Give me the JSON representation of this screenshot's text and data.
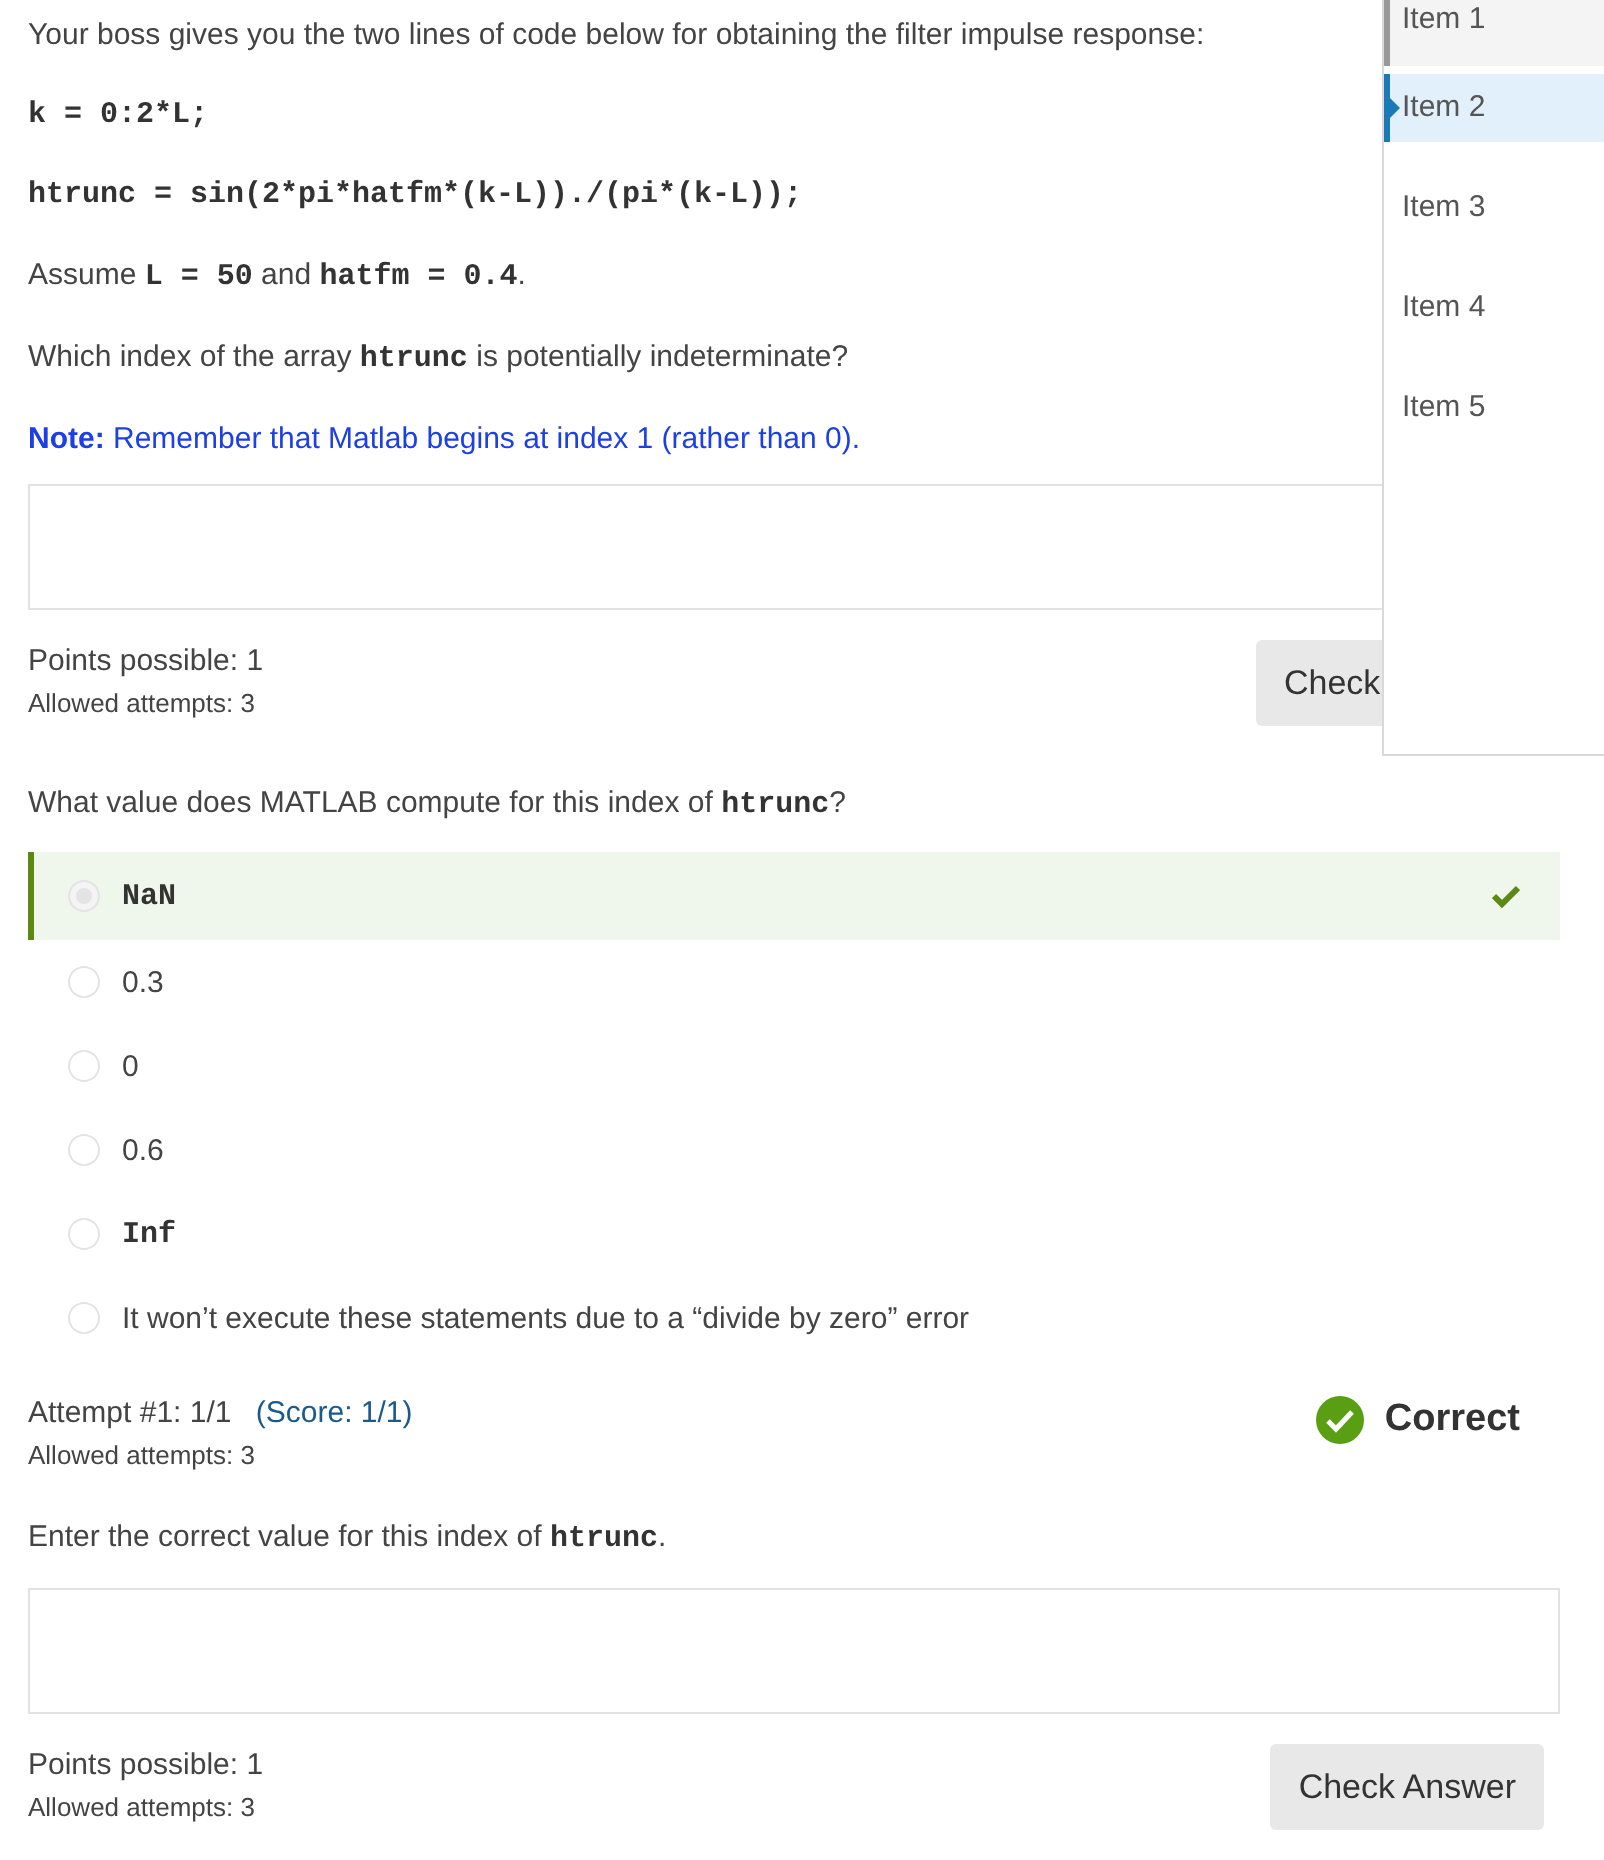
{
  "problem_1": {
    "paragraphs": [
      {
        "kind": "text",
        "segments": [
          {
            "text": "Your boss gives you the two lines of code below for obtaining the filter impulse response:",
            "kind": "text"
          }
        ]
      },
      {
        "kind": "code",
        "text": "k = 0:2*L;"
      },
      {
        "kind": "code",
        "text": "htrunc = sin(2*pi*hatfm*(k-L))./(pi*(k-L));"
      },
      {
        "kind": "text",
        "segments": [
          {
            "text": "Assume ",
            "kind": "text"
          },
          {
            "text": "L = 50",
            "kind": "code"
          },
          {
            "text": " and ",
            "kind": "text"
          },
          {
            "text": "hatfm = 0.4",
            "kind": "code"
          },
          {
            "text": ".",
            "kind": "text"
          }
        ]
      },
      {
        "kind": "text",
        "segments": [
          {
            "text": "Which index of the array ",
            "kind": "text"
          },
          {
            "text": "htrunc",
            "kind": "code"
          },
          {
            "text": " is potentially indeterminate?",
            "kind": "text"
          }
        ]
      },
      {
        "kind": "note",
        "rich": "**Note:** Remember that Matlab begins at index 1 (rather than 0)."
      }
    ],
    "points": "Points possible: 1",
    "attempts": "Allowed attempts: 3",
    "button": "Check"
  },
  "problem_2": {
    "question": [
      {
        "text": "What value does MATLAB compute for this index of ",
        "kind": "text"
      },
      {
        "text": "htrunc",
        "kind": "code"
      },
      {
        "text": "?",
        "kind": "text"
      }
    ],
    "options": [
      {
        "label": "NaN",
        "kind": "code",
        "selected": true
      },
      {
        "label": "0.3",
        "kind": "text",
        "selected": false
      },
      {
        "label": "0",
        "kind": "text",
        "selected": false
      },
      {
        "label": "0.6",
        "kind": "text",
        "selected": false
      },
      {
        "label": "Inf",
        "kind": "code",
        "selected": false
      },
      {
        "label": "It won’t execute these statements due to a “divide by zero” error",
        "kind": "text",
        "selected": false
      }
    ],
    "correct": true,
    "attempt": "Attempt #1: 1/1",
    "score": "(Score: 1/1)",
    "attempts": "Allowed attempts: 3",
    "status": "Correct"
  },
  "problem_3": {
    "question": [
      {
        "text": "Enter the correct value for this index of ",
        "kind": "text"
      },
      {
        "text": "htrunc",
        "kind": "code"
      },
      {
        "text": ".",
        "kind": "text"
      }
    ],
    "points": "Points possible: 1",
    "attempts": "Allowed attempts: 3",
    "button": "Check Answer"
  },
  "menu": {
    "items": [
      {
        "label": "Item 1",
        "selected": false,
        "hovered": true
      },
      {
        "label": "Item 2",
        "selected": true,
        "hovered": false
      },
      {
        "label": "Item 3",
        "selected": false,
        "hovered": false
      },
      {
        "label": "Item 4",
        "selected": false,
        "hovered": false
      },
      {
        "label": "Item 5",
        "selected": false,
        "hovered": false
      }
    ]
  }
}
